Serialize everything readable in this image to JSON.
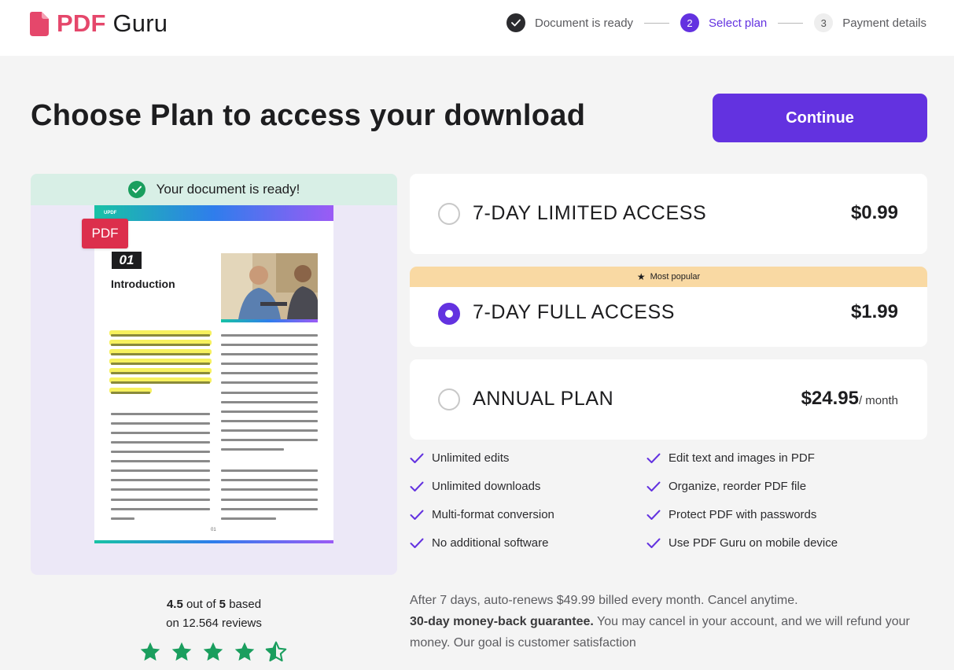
{
  "header": {
    "logo_pdf": "PDF",
    "logo_guru": "Guru",
    "steps": [
      {
        "number": "",
        "label": "Document is ready",
        "state": "done"
      },
      {
        "number": "2",
        "label": "Select plan",
        "state": "active"
      },
      {
        "number": "3",
        "label": "Payment details",
        "state": "idle"
      }
    ]
  },
  "main": {
    "title": "Choose Plan to access your download",
    "continue_label": "Continue"
  },
  "preview": {
    "ready_text": "Your document is ready!",
    "pdf_badge": "PDF",
    "doc_brand": "UPDF",
    "doc_number": "01",
    "doc_heading": "Introduction",
    "doc_page_number": "01"
  },
  "rating": {
    "score": "4.5",
    "out_of_text": "out of",
    "max": "5",
    "based_text": "based",
    "reviews_text": "on 12.564 reviews",
    "stars_value": 4.5,
    "star_color": "#1a9e5e"
  },
  "plans": [
    {
      "name": "7-DAY LIMITED ACCESS",
      "price": "$0.99",
      "period": "",
      "selected": false
    },
    {
      "name": "7-DAY FULL ACCESS",
      "price": "$1.99",
      "period": "",
      "selected": true,
      "badge": "Most popular"
    },
    {
      "name": "ANNUAL PLAN",
      "price": "$24.95",
      "period": "/ month",
      "selected": false
    }
  ],
  "features": [
    "Unlimited edits",
    "Edit text and images in PDF",
    "Unlimited downloads",
    "Organize, reorder PDF file",
    "Multi-format conversion",
    "Protect PDF with passwords",
    "No additional software",
    "Use PDF Guru on mobile device"
  ],
  "notes": {
    "renewal": "After 7 days, auto-renews $49.99 billed every month. Cancel anytime.",
    "guarantee_bold": "30-day money-back guarantee.",
    "guarantee_rest": " You may cancel in your account, and we will refund your money. Our goal is customer satisfaction"
  },
  "colors": {
    "accent": "#6332e0",
    "brand": "#e5476b",
    "success": "#1a9e5e",
    "popular": "#f9d9a3"
  }
}
